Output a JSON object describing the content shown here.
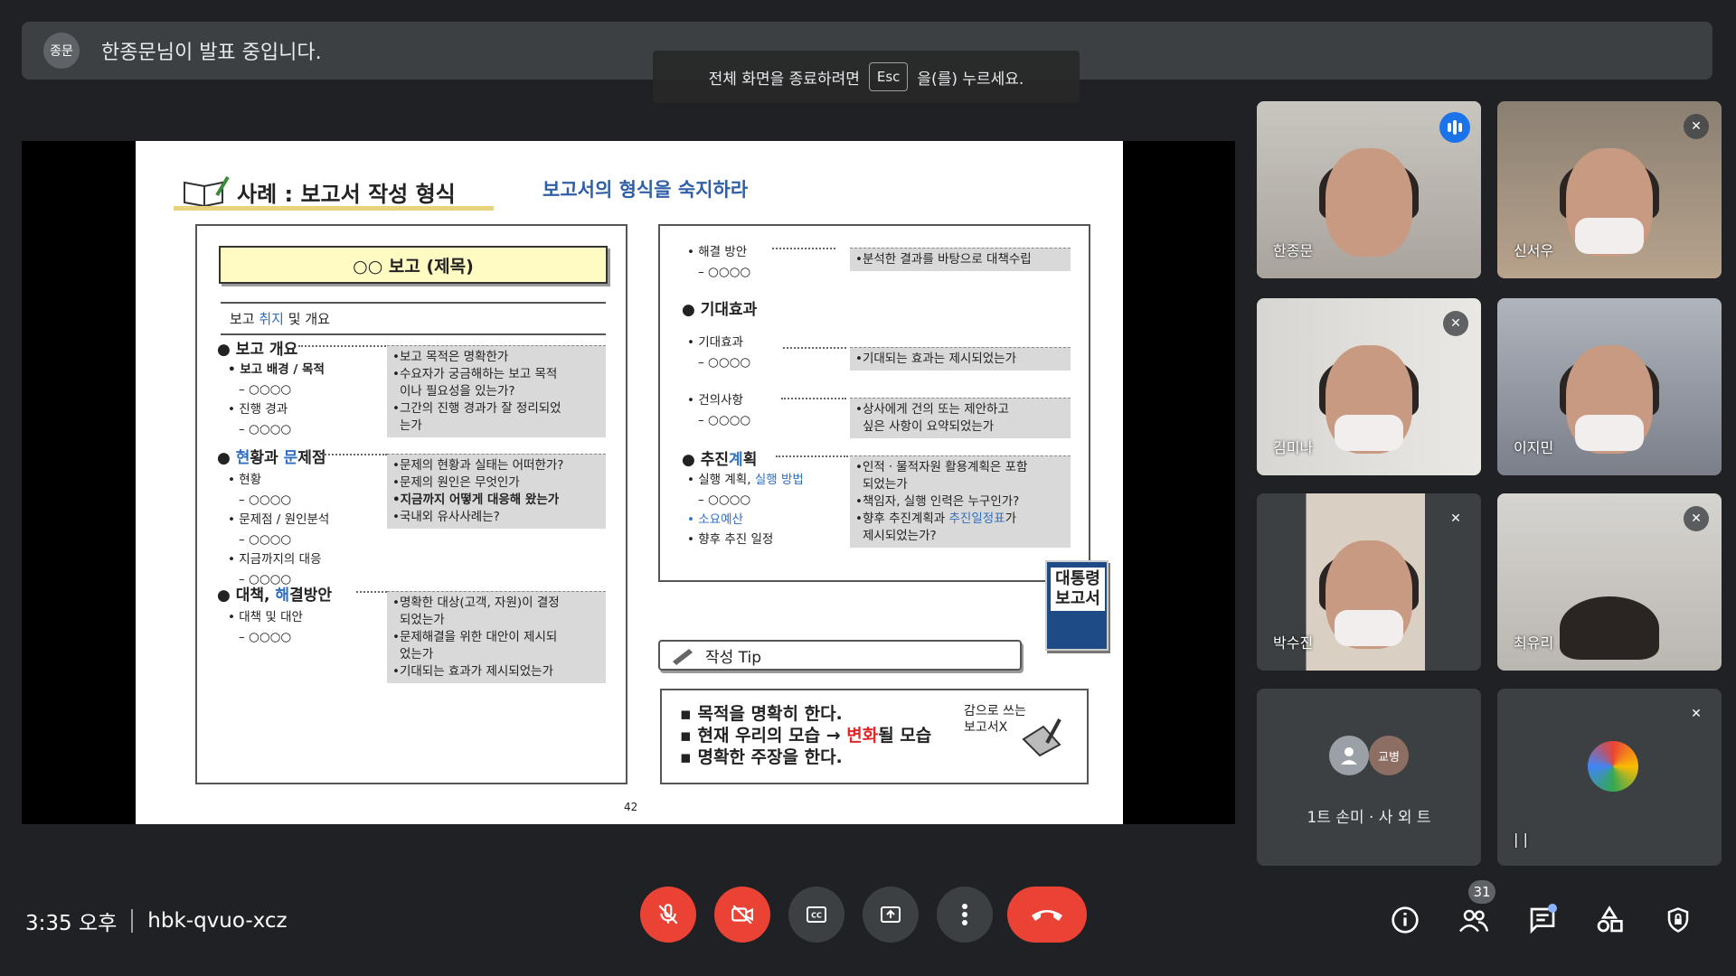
{
  "presenter_bar": {
    "avatar_label": "종문",
    "text": "한종문님이 발표 중입니다."
  },
  "fullscreen_hint": {
    "before": "전체 화면을 종료하려면",
    "key": "Esc",
    "after": "을(를) 누르세요."
  },
  "slide": {
    "title": "사례 : 보고서 작성 형식",
    "subtitle": "보고서의 형식을 숙지하라",
    "report_title": "○○ 보고 (제목)",
    "purpose": {
      "a": "보고 ",
      "b": "취지",
      "c": " 및 개요"
    },
    "sec1": {
      "head": "● 보고 개요",
      "items": [
        "• 보고 배경 / 목적",
        "– ○○○○",
        "• 진행 경과",
        "– ○○○○"
      ],
      "notes": [
        "•보고 목적은 명확한가",
        "•수요자가 궁금해하는 보고 목적",
        "이나 필요성을 있는가?",
        "•그간의 진행 경과가 잘 정리되었",
        "는가"
      ]
    },
    "sec2": {
      "head_a": "● ",
      "head_b": "현",
      "head_c": "황과 ",
      "head_d": "문",
      "head_e": "제점",
      "items": [
        "• 현황",
        "– ○○○○",
        "• 문제점 / 원인분석",
        "– ○○○○",
        "• 지금까지의 대응",
        "– ○○○○"
      ],
      "notes": [
        "•문제의 현황과 실태는 어떠한가?",
        "•문제의 원인은 무엇인가",
        "•지금까지 어떻게 대응해 왔는가",
        "•국내외 유사사례는?"
      ]
    },
    "sec3": {
      "head_a": "● 대책, ",
      "head_b": "해",
      "head_c": "결방안",
      "items": [
        "• 대책 및 대안",
        "– ○○○○"
      ],
      "notes": [
        "•명확한 대상(고객, 자원)이 결정",
        "되었는가",
        "•문제해결을 위한 대안이 제시되",
        "었는가",
        "•기대되는 효과가 제시되었는가"
      ]
    },
    "r_solution": {
      "items": [
        "• 해결 방안",
        "– ○○○○"
      ],
      "note": "•분석한 결과를 바탕으로 대책수립"
    },
    "r_effect": {
      "head": "● 기대효과",
      "item1": [
        "• 기대효과",
        "– ○○○○"
      ],
      "note1": "•기대되는 효과는 제시되었는가",
      "item2": [
        "• 건의사항",
        "– ○○○○"
      ],
      "note2": [
        "•상사에게 건의 또는 제안하고",
        "싶은 사항이 요약되었는가"
      ]
    },
    "r_plan": {
      "head_a": "● 추진",
      "head_b": "계",
      "head_c": "획",
      "item1_a": "• 실행 계획, ",
      "item1_b": "실행 방법",
      "item2": "– ○○○○",
      "item3": "• 소요예산",
      "item4": "• 향후 추진 일정",
      "notes": [
        "•인적ㆍ물적자원 활용계획은 포함",
        "되었는가",
        "•책임자, 실행 인력은 누구인가?"
      ],
      "note_last_a": "•향후 추진계획과 ",
      "note_last_b": "추진일정표",
      "note_last_c": "가",
      "note_last_d": "제시되었는가?"
    },
    "book_cover": [
      "대통령",
      "보고서"
    ],
    "tip_label": "작성 Tip",
    "tip": {
      "l1": "▪ 목적을 명확히 한다.",
      "l2_a": "▪ 현재 우리의 모습 → ",
      "l2_b": "변화",
      "l2_c": "될 모습",
      "l3": "▪ 명확한 주장을 한다.",
      "side1": "감으로 쓰는",
      "side2": "보고서X"
    },
    "page_number": "42"
  },
  "participants": [
    {
      "name": "한종문",
      "status": "speaking"
    },
    {
      "name": "신서우",
      "status": "muted"
    },
    {
      "name": "김미나",
      "status": "muted"
    },
    {
      "name": "이지민",
      "status": "unmuted"
    },
    {
      "name": "박수진",
      "status": "muted"
    },
    {
      "name": "최유리",
      "status": "muted"
    }
  ],
  "others_tile": {
    "text": "1트 손미 · 사 외 트",
    "avatar2": "교병"
  },
  "last_tile": {
    "name": "| |"
  },
  "bottom": {
    "time": "3:35 오후",
    "meeting_code": "hbk-qvuo-xcz",
    "participant_count": "31"
  },
  "colors": {
    "accent": "#1a73e8",
    "danger": "#ea4335",
    "bg": "#202124"
  }
}
